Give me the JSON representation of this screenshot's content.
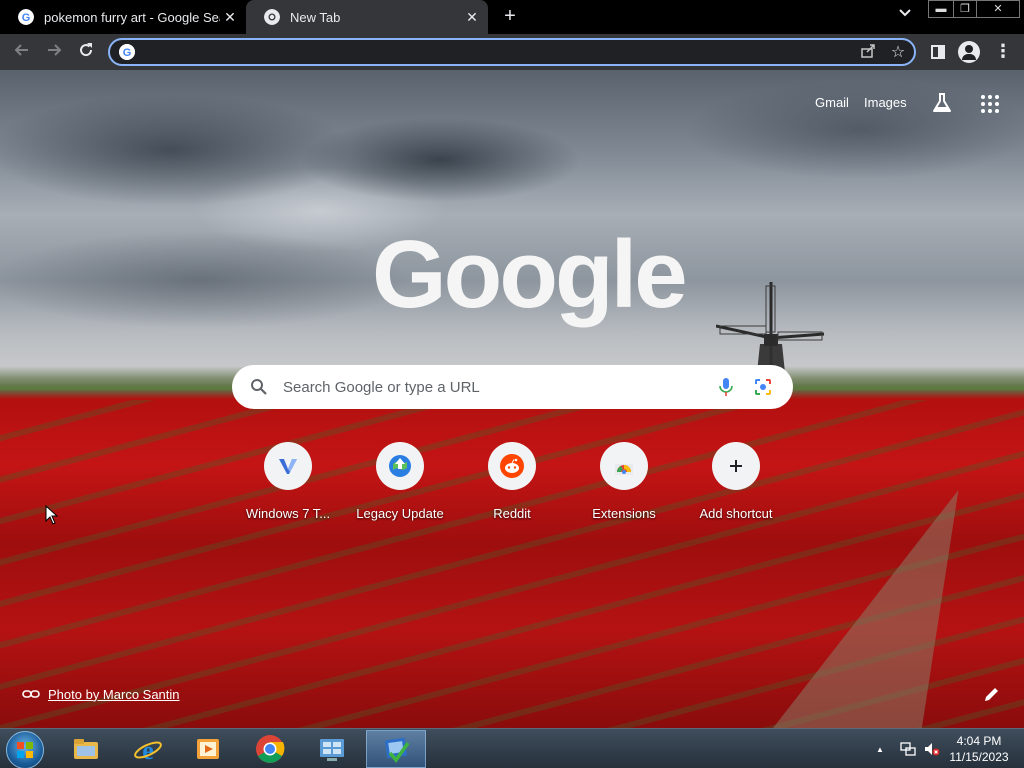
{
  "tabs": [
    {
      "title": "pokemon furry art - Google Sear",
      "active": false
    },
    {
      "title": "New Tab",
      "active": true
    }
  ],
  "toolbar": {
    "omnibox_value": "",
    "omnibox_placeholder": ""
  },
  "ntp": {
    "links": {
      "gmail": "Gmail",
      "images": "Images"
    },
    "logo_text": "Google",
    "search_placeholder": "Search Google or type a URL",
    "shortcuts": [
      {
        "label": "Windows 7 T...",
        "icon": "windows7-tweaks-icon"
      },
      {
        "label": "Legacy Update",
        "icon": "legacy-update-icon"
      },
      {
        "label": "Reddit",
        "icon": "reddit-icon"
      },
      {
        "label": "Extensions",
        "icon": "chrome-web-store-icon"
      },
      {
        "label": "Add shortcut",
        "icon": "plus-icon"
      }
    ],
    "photo_credit": "Photo by Marco Santin"
  },
  "taskbar": {
    "apps": [
      "file-explorer",
      "internet-explorer",
      "media-player",
      "google-chrome",
      "control-panel",
      "settings-check"
    ],
    "clock_time": "4:04 PM",
    "clock_date": "11/15/2023"
  },
  "colors": {
    "accent": "#8ab4f8",
    "toolbar": "#35363a",
    "omnibox": "#202124",
    "reddit": "#ff4500"
  }
}
